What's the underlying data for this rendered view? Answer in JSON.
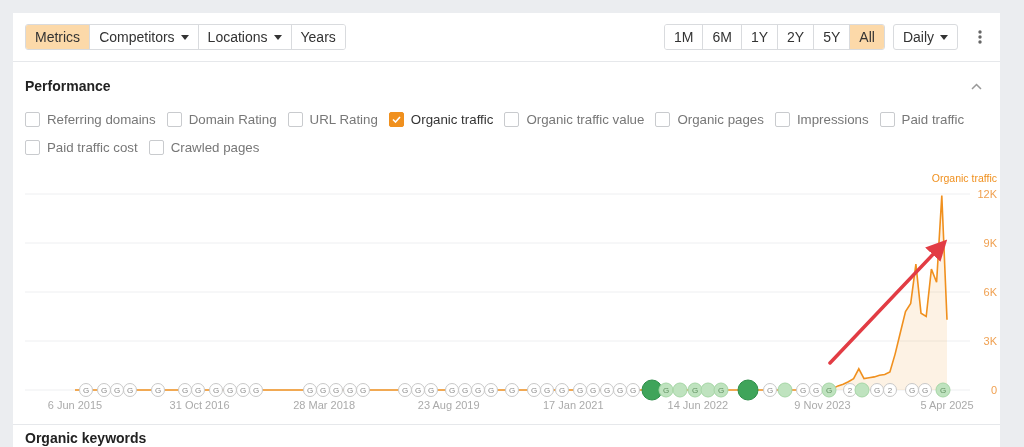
{
  "toolbar": {
    "tabs": [
      {
        "label": "Metrics",
        "selected": true,
        "dropdown": false
      },
      {
        "label": "Competitors",
        "selected": false,
        "dropdown": true
      },
      {
        "label": "Locations",
        "selected": false,
        "dropdown": true
      },
      {
        "label": "Years",
        "selected": false,
        "dropdown": false
      }
    ],
    "periods": [
      {
        "label": "1M",
        "selected": false
      },
      {
        "label": "6M",
        "selected": false
      },
      {
        "label": "1Y",
        "selected": false
      },
      {
        "label": "2Y",
        "selected": false
      },
      {
        "label": "5Y",
        "selected": false
      },
      {
        "label": "All",
        "selected": true
      }
    ],
    "interval": {
      "label": "Daily"
    }
  },
  "performance": {
    "title": "Performance",
    "expanded": true,
    "metrics": [
      {
        "label": "Referring domains",
        "checked": false
      },
      {
        "label": "Domain Rating",
        "checked": false
      },
      {
        "label": "URL Rating",
        "checked": false
      },
      {
        "label": "Organic traffic",
        "checked": true
      },
      {
        "label": "Organic traffic value",
        "checked": false
      },
      {
        "label": "Organic pages",
        "checked": false
      },
      {
        "label": "Impressions",
        "checked": false
      },
      {
        "label": "Paid traffic",
        "checked": false
      },
      {
        "label": "Paid traffic cost",
        "checked": false
      },
      {
        "label": "Crawled pages",
        "checked": false
      }
    ],
    "chart_data": {
      "type": "area",
      "categories": [
        "6 Jun 2015",
        null,
        null,
        null,
        null,
        null,
        null,
        null,
        null,
        null,
        null,
        null,
        null,
        null,
        null,
        null,
        null,
        null,
        null,
        null,
        null,
        null,
        null,
        null,
        "31 Oct 2016",
        null,
        null,
        null,
        null,
        null,
        null,
        null,
        null,
        null,
        null,
        null,
        null,
        null,
        null,
        null,
        null,
        null,
        null,
        null,
        null,
        null,
        null,
        null,
        "28 Mar 2018",
        null,
        null,
        null,
        null,
        null,
        null,
        null,
        null,
        null,
        null,
        null,
        null,
        null,
        null,
        null,
        null,
        null,
        null,
        null,
        null,
        null,
        null,
        null,
        "23 Aug 2019",
        null,
        null,
        null,
        null,
        null,
        null,
        null,
        null,
        null,
        null,
        null,
        null,
        null,
        null,
        null,
        null,
        null,
        null,
        null,
        null,
        null,
        null,
        null,
        "17 Jan 2021",
        null,
        null,
        null,
        null,
        null,
        null,
        null,
        null,
        null,
        null,
        null,
        null,
        null,
        null,
        null,
        null,
        null,
        null,
        null,
        null,
        null,
        null,
        null,
        "14 Jun 2022",
        null,
        null,
        null,
        null,
        null,
        null,
        null,
        null,
        null,
        null,
        null,
        null,
        null,
        null,
        null,
        null,
        null,
        null,
        null,
        null,
        null,
        null,
        null,
        "9 Nov 2023",
        null,
        null,
        null,
        null,
        null,
        null,
        null,
        null,
        null,
        null,
        null,
        null,
        null,
        null,
        null,
        null,
        null,
        null,
        null,
        null,
        null,
        null,
        null,
        "5 Apr 2025"
      ],
      "series": [
        {
          "name": "Organic traffic",
          "color": "#f0901e",
          "values": [
            0,
            0,
            0,
            0,
            0,
            0,
            0,
            0,
            0,
            0,
            0,
            0,
            0,
            0,
            0,
            0,
            0,
            0,
            0,
            0,
            0,
            0,
            0,
            0,
            0,
            0,
            0,
            0,
            0,
            0,
            0,
            0,
            0,
            0,
            0,
            0,
            0,
            0,
            0,
            0,
            0,
            0,
            0,
            0,
            0,
            0,
            0,
            0,
            0,
            0,
            0,
            0,
            0,
            0,
            0,
            0,
            0,
            0,
            0,
            0,
            0,
            0,
            0,
            0,
            0,
            0,
            0,
            0,
            0,
            0,
            0,
            0,
            0,
            0,
            0,
            0,
            0,
            0,
            0,
            0,
            0,
            0,
            0,
            0,
            0,
            0,
            0,
            0,
            0,
            0,
            0,
            0,
            0,
            0,
            0,
            0,
            0,
            0,
            0,
            0,
            0,
            0,
            0,
            0,
            0,
            0,
            0,
            0,
            0,
            0,
            0,
            0,
            0,
            0,
            0,
            0,
            0,
            0,
            0,
            0,
            0,
            0,
            0,
            0,
            0,
            0,
            0,
            0,
            0,
            0,
            0,
            0,
            0,
            0,
            0,
            0,
            0,
            0,
            0,
            0,
            0,
            0,
            0,
            0,
            0,
            0,
            100,
            250,
            350,
            500,
            700,
            1300,
            700,
            750,
            800,
            900,
            950,
            1100,
            2200,
            3500,
            4800,
            5300,
            7700,
            4700,
            4500,
            7400,
            6600,
            11900,
            4300
          ]
        }
      ],
      "ylim": [
        0,
        12000
      ],
      "grid": true,
      "yticks": [
        {
          "value": 0,
          "label": "0"
        },
        {
          "value": 3000,
          "label": "3K"
        },
        {
          "value": 6000,
          "label": "6K"
        },
        {
          "value": 9000,
          "label": "9K"
        },
        {
          "value": 12000,
          "label": "12K"
        }
      ]
    },
    "markers": [
      {
        "label": "G",
        "kind": "plain"
      },
      {
        "label": "G",
        "kind": "plain"
      },
      {
        "label": "G",
        "kind": "plain"
      },
      {
        "label": "G",
        "kind": "plain"
      },
      {
        "label": "G",
        "kind": "plain"
      },
      {
        "label": "G",
        "kind": "plain"
      },
      {
        "label": "G",
        "kind": "plain"
      },
      {
        "label": "G",
        "kind": "plain"
      },
      {
        "label": "G",
        "kind": "plain"
      },
      {
        "label": "G",
        "kind": "plain"
      },
      {
        "label": "G",
        "kind": "plain"
      },
      {
        "label": "G",
        "kind": "plain"
      },
      {
        "label": "G",
        "kind": "plain"
      },
      {
        "label": "G",
        "kind": "plain"
      },
      {
        "label": "G",
        "kind": "plain"
      },
      {
        "label": "G",
        "kind": "plain"
      },
      {
        "label": "G",
        "kind": "plain"
      },
      {
        "label": "G",
        "kind": "plain"
      },
      {
        "label": "G",
        "kind": "plain"
      },
      {
        "label": "G",
        "kind": "plain"
      },
      {
        "label": "G",
        "kind": "plain"
      },
      {
        "label": "G",
        "kind": "plain"
      },
      {
        "label": "G",
        "kind": "plain"
      },
      {
        "label": "G",
        "kind": "plain"
      },
      {
        "label": "G",
        "kind": "plain"
      },
      {
        "label": "G",
        "kind": "plain"
      },
      {
        "label": "G",
        "kind": "plain"
      },
      {
        "label": "G",
        "kind": "plain"
      },
      {
        "label": "G",
        "kind": "plain"
      },
      {
        "label": "G",
        "kind": "plain"
      },
      {
        "label": "G",
        "kind": "plain"
      },
      {
        "label": "G",
        "kind": "plain"
      },
      {
        "kind": "large"
      },
      {
        "label": "G",
        "kind": "green"
      },
      {
        "kind": "green"
      },
      {
        "label": "G",
        "kind": "green"
      },
      {
        "kind": "green"
      },
      {
        "label": "G",
        "kind": "green"
      },
      {
        "kind": "large"
      },
      {
        "label": "G",
        "kind": "plain"
      },
      {
        "kind": "green"
      },
      {
        "label": "G",
        "kind": "plain"
      },
      {
        "label": "G",
        "kind": "plain"
      },
      {
        "label": "G",
        "kind": "green"
      },
      {
        "label": "2",
        "kind": "plain"
      },
      {
        "kind": "green"
      },
      {
        "label": "G",
        "kind": "plain"
      },
      {
        "label": "2",
        "kind": "plain"
      },
      {
        "label": "G",
        "kind": "plain"
      },
      {
        "label": "G",
        "kind": "plain"
      },
      {
        "label": "G",
        "kind": "green"
      }
    ]
  },
  "next_section": {
    "title": "Organic keywords"
  }
}
